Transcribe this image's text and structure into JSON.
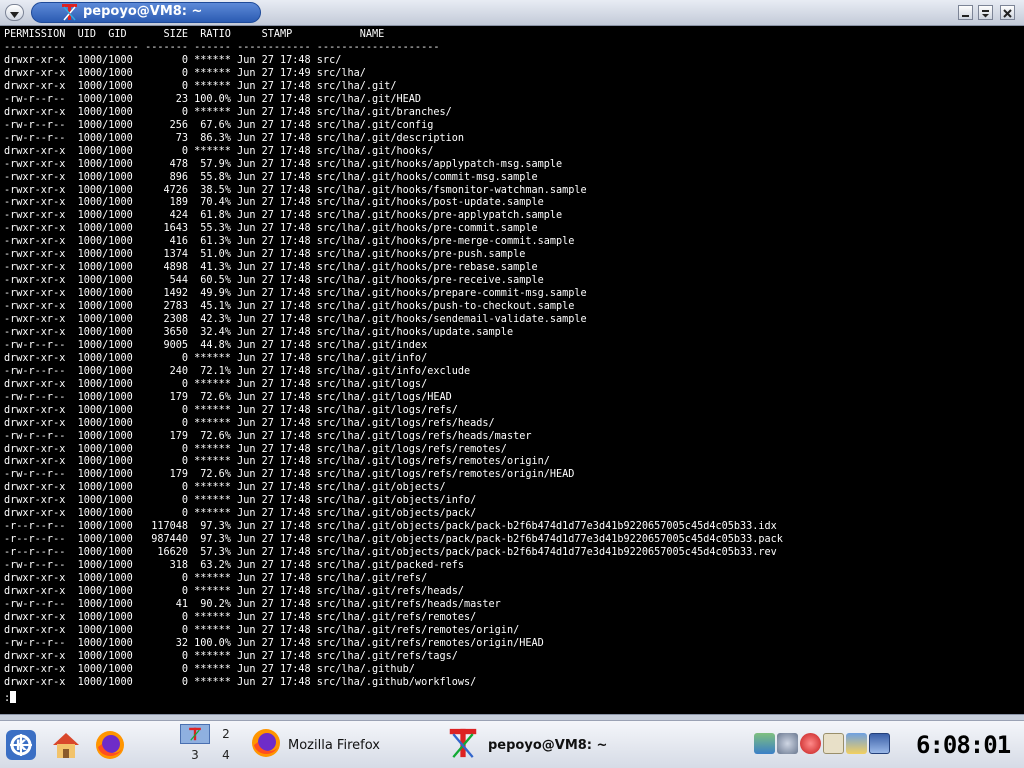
{
  "window": {
    "title": "pepoyo@VM8: ~",
    "menu_icon": "chevron-down-icon",
    "buttons": [
      "minimize-icon",
      "maximize-icon",
      "close-icon"
    ]
  },
  "terminal": {
    "header": "PERMISSION  UID  GID      SIZE  RATIO     STAMP           NAME",
    "separator": "---------- ----------- ------- ------ ------------ --------------------",
    "rows": [
      "drwxr-xr-x  1000/1000        0 ****** Jun 27 17:48 src/",
      "drwxr-xr-x  1000/1000        0 ****** Jun 27 17:49 src/lha/",
      "drwxr-xr-x  1000/1000        0 ****** Jun 27 17:48 src/lha/.git/",
      "-rw-r--r--  1000/1000       23 100.0% Jun 27 17:48 src/lha/.git/HEAD",
      "drwxr-xr-x  1000/1000        0 ****** Jun 27 17:48 src/lha/.git/branches/",
      "-rw-r--r--  1000/1000      256  67.6% Jun 27 17:48 src/lha/.git/config",
      "-rw-r--r--  1000/1000       73  86.3% Jun 27 17:48 src/lha/.git/description",
      "drwxr-xr-x  1000/1000        0 ****** Jun 27 17:48 src/lha/.git/hooks/",
      "-rwxr-xr-x  1000/1000      478  57.9% Jun 27 17:48 src/lha/.git/hooks/applypatch-msg.sample",
      "-rwxr-xr-x  1000/1000      896  55.8% Jun 27 17:48 src/lha/.git/hooks/commit-msg.sample",
      "-rwxr-xr-x  1000/1000     4726  38.5% Jun 27 17:48 src/lha/.git/hooks/fsmonitor-watchman.sample",
      "-rwxr-xr-x  1000/1000      189  70.4% Jun 27 17:48 src/lha/.git/hooks/post-update.sample",
      "-rwxr-xr-x  1000/1000      424  61.8% Jun 27 17:48 src/lha/.git/hooks/pre-applypatch.sample",
      "-rwxr-xr-x  1000/1000     1643  55.3% Jun 27 17:48 src/lha/.git/hooks/pre-commit.sample",
      "-rwxr-xr-x  1000/1000      416  61.3% Jun 27 17:48 src/lha/.git/hooks/pre-merge-commit.sample",
      "-rwxr-xr-x  1000/1000     1374  51.0% Jun 27 17:48 src/lha/.git/hooks/pre-push.sample",
      "-rwxr-xr-x  1000/1000     4898  41.3% Jun 27 17:48 src/lha/.git/hooks/pre-rebase.sample",
      "-rwxr-xr-x  1000/1000      544  60.5% Jun 27 17:48 src/lha/.git/hooks/pre-receive.sample",
      "-rwxr-xr-x  1000/1000     1492  49.9% Jun 27 17:48 src/lha/.git/hooks/prepare-commit-msg.sample",
      "-rwxr-xr-x  1000/1000     2783  45.1% Jun 27 17:48 src/lha/.git/hooks/push-to-checkout.sample",
      "-rwxr-xr-x  1000/1000     2308  42.3% Jun 27 17:48 src/lha/.git/hooks/sendemail-validate.sample",
      "-rwxr-xr-x  1000/1000     3650  32.4% Jun 27 17:48 src/lha/.git/hooks/update.sample",
      "-rw-r--r--  1000/1000     9005  44.8% Jun 27 17:48 src/lha/.git/index",
      "drwxr-xr-x  1000/1000        0 ****** Jun 27 17:48 src/lha/.git/info/",
      "-rw-r--r--  1000/1000      240  72.1% Jun 27 17:48 src/lha/.git/info/exclude",
      "drwxr-xr-x  1000/1000        0 ****** Jun 27 17:48 src/lha/.git/logs/",
      "-rw-r--r--  1000/1000      179  72.6% Jun 27 17:48 src/lha/.git/logs/HEAD",
      "drwxr-xr-x  1000/1000        0 ****** Jun 27 17:48 src/lha/.git/logs/refs/",
      "drwxr-xr-x  1000/1000        0 ****** Jun 27 17:48 src/lha/.git/logs/refs/heads/",
      "-rw-r--r--  1000/1000      179  72.6% Jun 27 17:48 src/lha/.git/logs/refs/heads/master",
      "drwxr-xr-x  1000/1000        0 ****** Jun 27 17:48 src/lha/.git/logs/refs/remotes/",
      "drwxr-xr-x  1000/1000        0 ****** Jun 27 17:48 src/lha/.git/logs/refs/remotes/origin/",
      "-rw-r--r--  1000/1000      179  72.6% Jun 27 17:48 src/lha/.git/logs/refs/remotes/origin/HEAD",
      "drwxr-xr-x  1000/1000        0 ****** Jun 27 17:48 src/lha/.git/objects/",
      "drwxr-xr-x  1000/1000        0 ****** Jun 27 17:48 src/lha/.git/objects/info/",
      "drwxr-xr-x  1000/1000        0 ****** Jun 27 17:48 src/lha/.git/objects/pack/",
      "-r--r--r--  1000/1000   117048  97.3% Jun 27 17:48 src/lha/.git/objects/pack/pack-b2f6b474d1d77e3d41b9220657005c45d4c05b33.idx",
      "-r--r--r--  1000/1000   987440  97.3% Jun 27 17:48 src/lha/.git/objects/pack/pack-b2f6b474d1d77e3d41b9220657005c45d4c05b33.pack",
      "-r--r--r--  1000/1000    16620  57.3% Jun 27 17:48 src/lha/.git/objects/pack/pack-b2f6b474d1d77e3d41b9220657005c45d4c05b33.rev",
      "-rw-r--r--  1000/1000      318  63.2% Jun 27 17:48 src/lha/.git/packed-refs",
      "drwxr-xr-x  1000/1000        0 ****** Jun 27 17:48 src/lha/.git/refs/",
      "drwxr-xr-x  1000/1000        0 ****** Jun 27 17:48 src/lha/.git/refs/heads/",
      "-rw-r--r--  1000/1000       41  90.2% Jun 27 17:48 src/lha/.git/refs/heads/master",
      "drwxr-xr-x  1000/1000        0 ****** Jun 27 17:48 src/lha/.git/refs/remotes/",
      "drwxr-xr-x  1000/1000        0 ****** Jun 27 17:48 src/lha/.git/refs/remotes/origin/",
      "-rw-r--r--  1000/1000       32 100.0% Jun 27 17:48 src/lha/.git/refs/remotes/origin/HEAD",
      "drwxr-xr-x  1000/1000        0 ****** Jun 27 17:48 src/lha/.git/refs/tags/",
      "drwxr-xr-x  1000/1000        0 ****** Jun 27 17:48 src/lha/.github/",
      "drwxr-xr-x  1000/1000        0 ****** Jun 27 17:48 src/lha/.github/workflows/"
    ],
    "prompt": ":"
  },
  "taskbar": {
    "launchers": [
      "kde-menu-icon",
      "home-icon",
      "firefox-icon"
    ],
    "pager": [
      "1",
      "2",
      "3",
      "4"
    ],
    "pager_active": "1",
    "tasks": [
      {
        "label": "Mozilla Firefox",
        "icon": "firefox-icon"
      },
      {
        "label": "pepoyo@VM8: ~",
        "icon": "terminal-icon",
        "active": true
      }
    ],
    "tray": [
      "network-icon",
      "settings-icon",
      "stop-icon",
      "klipper-icon",
      "display-icon",
      "monitor-icon"
    ],
    "clock": "6:08:01"
  }
}
